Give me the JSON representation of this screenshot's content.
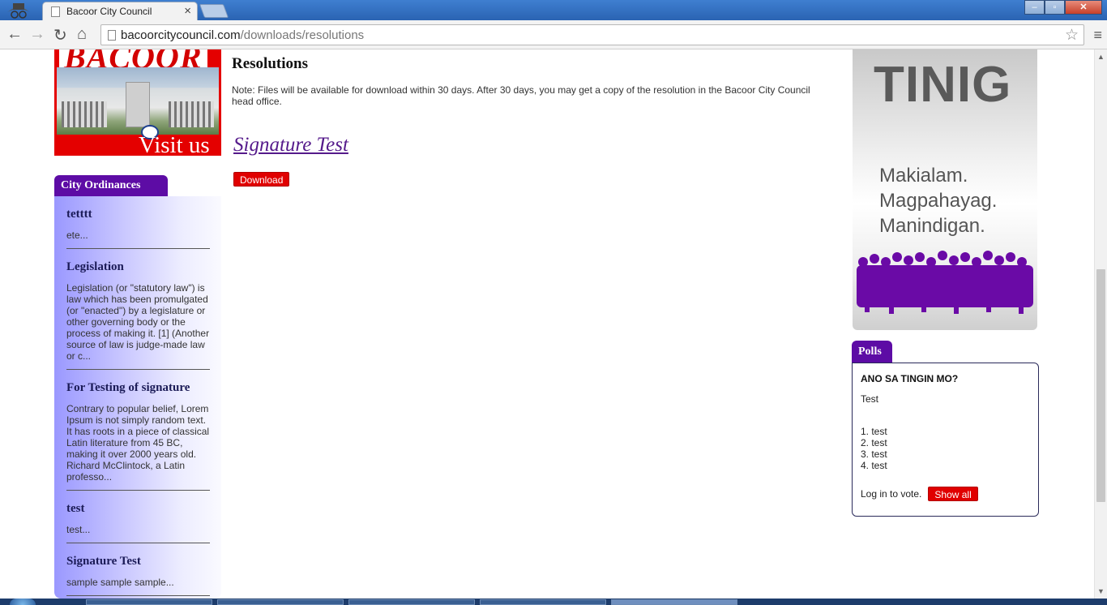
{
  "browser": {
    "tab_title": "Bacoor City Council",
    "tab_close": "×",
    "url_host": "bacoorcitycouncil.com",
    "url_path": "/downloads/resolutions",
    "window_controls": {
      "minimize": "–",
      "maximize": "▫",
      "close": "✕"
    },
    "nav": {
      "back": "←",
      "forward": "→",
      "reload": "↻",
      "home": "⌂",
      "star": "☆",
      "menu": "≡"
    }
  },
  "left": {
    "banner": {
      "brand": "BACOOR",
      "visit": "Visit us"
    },
    "ordinances": {
      "heading": "City Ordinances",
      "items": [
        {
          "title": "tetttt",
          "desc": "ete..."
        },
        {
          "title": "Legislation",
          "desc": "Legislation (or \"statutory law\") is law which has been promulgated (or \"enacted\") by a legislature or other governing body or the process of making it. [1] (Another source of law is judge-made law or c..."
        },
        {
          "title": "For Testing of signature",
          "desc": "Contrary to popular belief, Lorem Ipsum is not simply random text. It has roots in a piece of classical Latin literature from 45 BC, making it over 2000 years old. Richard McClintock, a Latin professo..."
        },
        {
          "title": "test",
          "desc": "test..."
        },
        {
          "title": "Signature Test",
          "desc": "sample sample sample..."
        }
      ]
    }
  },
  "main": {
    "title": "Resolutions",
    "note": "Note: Files will be available for download within 30 days. After 30 days, you may get a copy of the resolution in the Bacoor City Council head office.",
    "document_title": "Signature Test",
    "download_label": "Download"
  },
  "right": {
    "tinig": {
      "word": "TINIG",
      "line1": "Makialam.",
      "line2": "Magpahayag.",
      "line3": "Manindigan."
    },
    "polls": {
      "heading": "Polls",
      "question": "ANO SA TINGIN MO?",
      "description": "Test",
      "options": [
        "1. test",
        "2. test",
        "3. test",
        "4. test"
      ],
      "login_text": "Log in to vote.",
      "show_all_label": "Show all"
    }
  },
  "colors": {
    "accent_purple": "#5d0ca5",
    "button_red": "#e00000",
    "link_visited": "#551a8b"
  }
}
